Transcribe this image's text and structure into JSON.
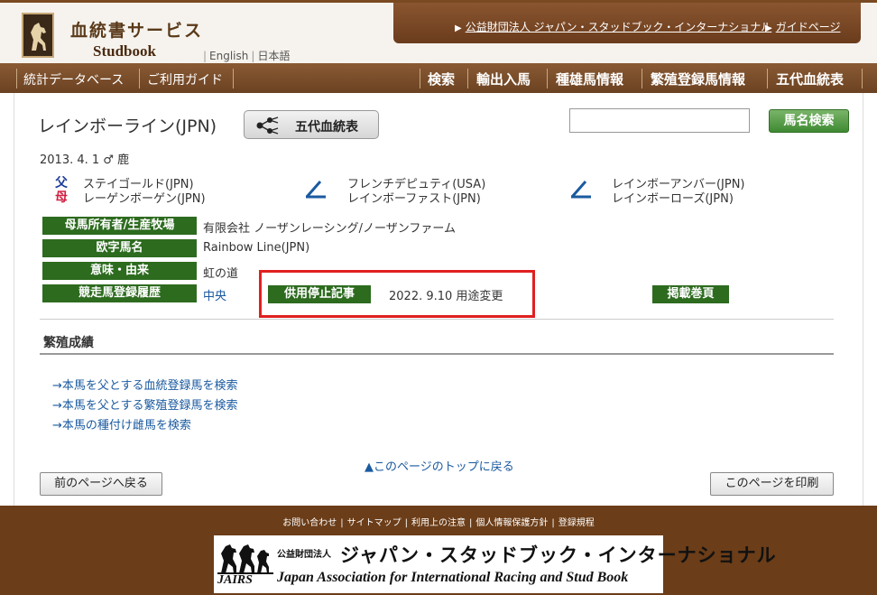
{
  "header": {
    "site_title": "血統書サービス",
    "site_subtitle": "Studbook",
    "lang_english": "English",
    "lang_japanese": "日本語",
    "org_link": "公益財団法人 ジャパン・スタッドブック・インターナショナル",
    "guide_link": "ガイドページ"
  },
  "nav": {
    "left": [
      "統計データベース",
      "ご利用ガイド"
    ],
    "right": [
      "検索",
      "輸出入馬",
      "種雄馬情報",
      "繁殖登録馬情報",
      "五代血統表"
    ]
  },
  "horse": {
    "name": "レインボーライン(JPN)",
    "pedigree_button": "五代血統表",
    "birth": "2013. 4. 1 ♂ 鹿",
    "sire_label": "父",
    "dam_label": "母",
    "sire": "ステイゴールド(JPN)",
    "dam": "レーゲンボーゲン(JPN)",
    "grandsire_sire": "フレンチデピュティ(USA)",
    "grandsire_dam": "レインボーファスト(JPN)",
    "ggrand_sire": "レインボーアンバー(JPN)",
    "ggrand_dam": "レインボーローズ(JPN)"
  },
  "search": {
    "input_value": "",
    "button_label": "馬名検索"
  },
  "fields": [
    {
      "label": "母馬所有者/生産牧場",
      "value": "有限会社 ノーザンレーシング/ノーザンファーム"
    },
    {
      "label": "欧字馬名",
      "value": "Rainbow Line(JPN)"
    },
    {
      "label": "意味・由来",
      "value": "虹の道"
    },
    {
      "label": "競走馬登録履歴",
      "value": "中央"
    }
  ],
  "stop": {
    "label": "供用停止記事",
    "value": "2022. 9.10 用途変更"
  },
  "page_label": "掲載巻頁",
  "breeding": {
    "title": "繁殖成績",
    "links": [
      "→本馬を父とする血統登録馬を検索",
      "→本馬を父とする繁殖登録馬を検索",
      "→本馬の種付け雌馬を検索"
    ]
  },
  "page_top_link": "▲このページのトップに戻る",
  "back_button": "前のページへ戻る",
  "print_button": "このページを印刷",
  "footer": {
    "links": [
      "お問い合わせ",
      "サイトマップ",
      "利用上の注意",
      "個人情報保護方針",
      "登録規程"
    ],
    "org_small": "公益財団法人",
    "org_name": "ジャパン・スタッドブック・インターナショナル",
    "org_en": "Japan Association for International Racing and Stud Book",
    "mark": "JAIRS"
  },
  "colors": {
    "brand_brown": "#6b3d18",
    "label_green": "#2d6b1f",
    "highlight_red": "#e02020",
    "link_blue": "#1a5aa0"
  }
}
